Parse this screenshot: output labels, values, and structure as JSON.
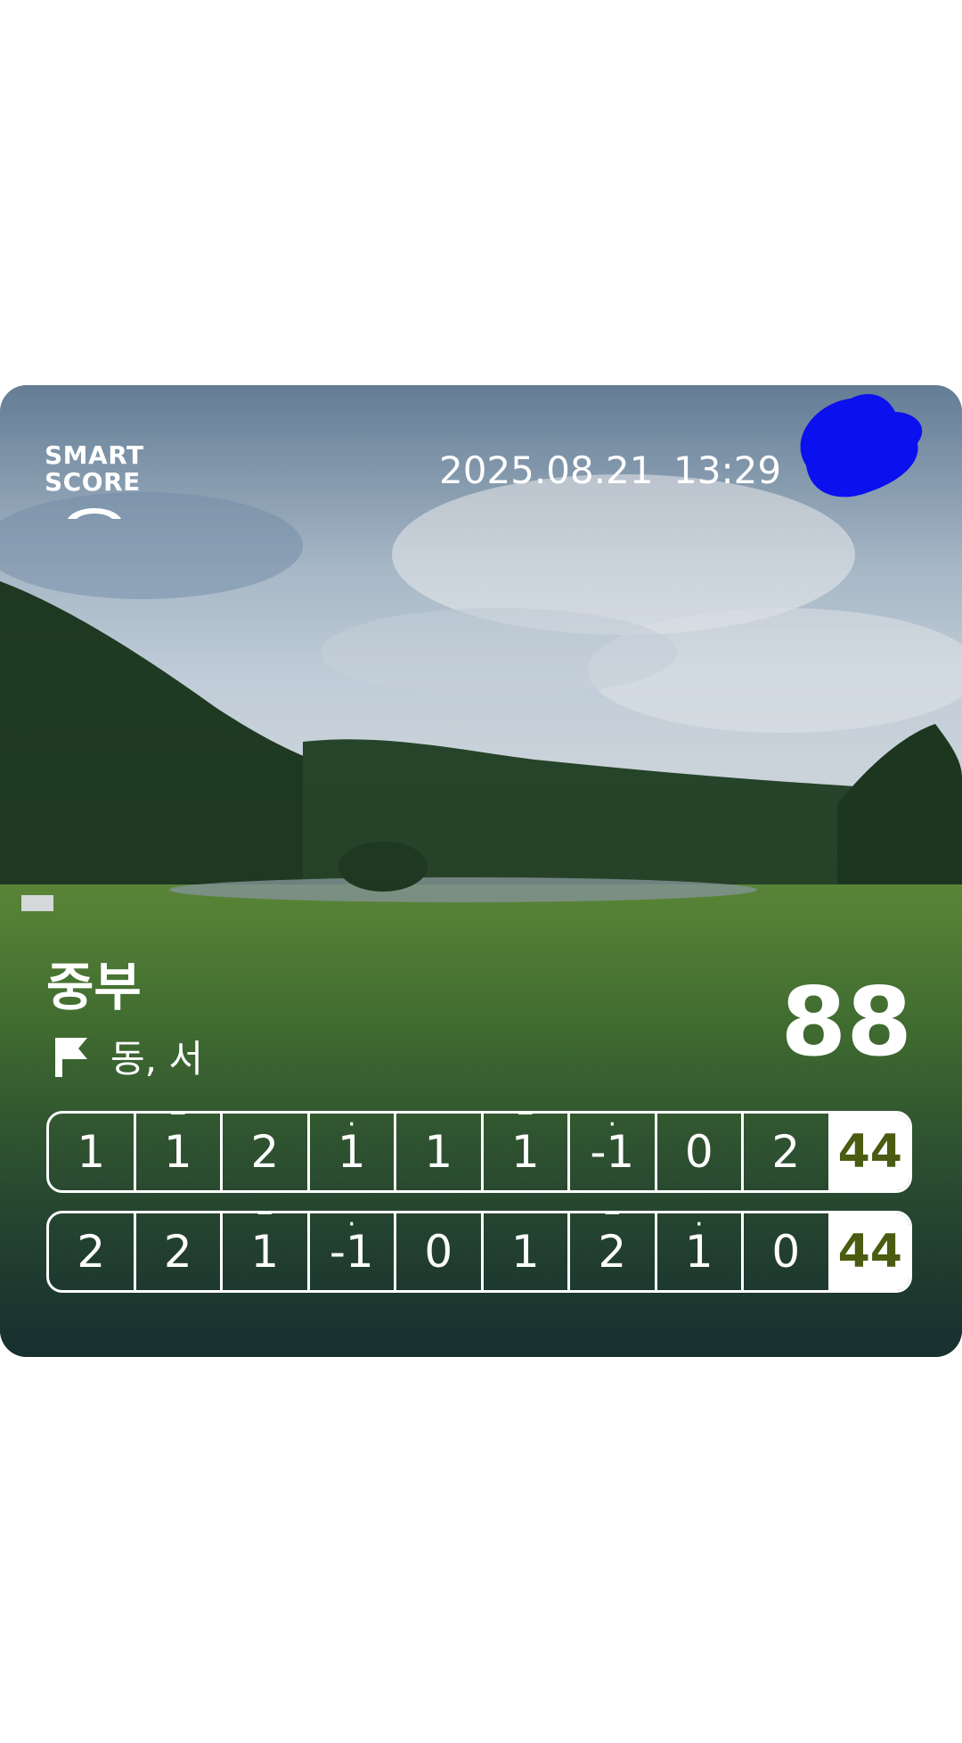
{
  "logo": {
    "line1": "SMART",
    "line2": "SCORE"
  },
  "date": "2025.08.21",
  "time": "13:29",
  "course": "중부",
  "sub_courses": "동, 서",
  "total": "88",
  "rows": [
    {
      "cells": [
        {
          "v": "1",
          "m": ""
        },
        {
          "v": "1",
          "m": "‾"
        },
        {
          "v": "2",
          "m": ""
        },
        {
          "v": "1",
          "m": "·"
        },
        {
          "v": "1",
          "m": ""
        },
        {
          "v": "1",
          "m": "‾"
        },
        {
          "v": "-1",
          "m": "·"
        },
        {
          "v": "0",
          "m": ""
        },
        {
          "v": "2",
          "m": ""
        }
      ],
      "sum": "44"
    },
    {
      "cells": [
        {
          "v": "2",
          "m": ""
        },
        {
          "v": "2",
          "m": ""
        },
        {
          "v": "1",
          "m": "‾"
        },
        {
          "v": "-1",
          "m": "·"
        },
        {
          "v": "0",
          "m": ""
        },
        {
          "v": "1",
          "m": ""
        },
        {
          "v": "2",
          "m": "‾"
        },
        {
          "v": "1",
          "m": "·"
        },
        {
          "v": "0",
          "m": ""
        }
      ],
      "sum": "44"
    }
  ],
  "colors": {
    "sum_text": "#4a5c12",
    "border": "#ffffff",
    "blob": "#0a10ee"
  },
  "icons": [
    "smart-score-logo-icon",
    "flag-icon"
  ]
}
